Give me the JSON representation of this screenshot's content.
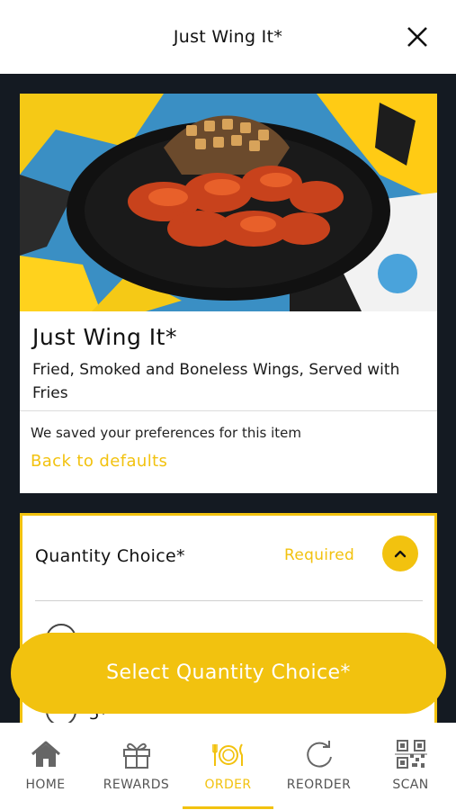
{
  "header": {
    "title": "Just Wing It*"
  },
  "item": {
    "name": "Just Wing It*",
    "description": "Fried, Smoked and Boneless Wings, Served with Fries",
    "preference_note": "We saved your preferences for this item",
    "back_to_defaults": "Back to defaults"
  },
  "quantity": {
    "label": "Quantity Choice*",
    "required": "Required",
    "options": [
      {
        "label": ""
      },
      {
        "label": "5*"
      }
    ]
  },
  "cta": {
    "label": "Select Quantity Choice*"
  },
  "nav": {
    "items": [
      {
        "label": "HOME",
        "icon": "home-icon"
      },
      {
        "label": "REWARDS",
        "icon": "gift-icon"
      },
      {
        "label": "ORDER",
        "icon": "plate-cutlery-icon"
      },
      {
        "label": "REORDER",
        "icon": "reorder-icon"
      },
      {
        "label": "SCAN",
        "icon": "qr-code-icon"
      }
    ],
    "active": "ORDER"
  },
  "colors": {
    "accent": "#f2c20f",
    "background": "#141a22"
  }
}
